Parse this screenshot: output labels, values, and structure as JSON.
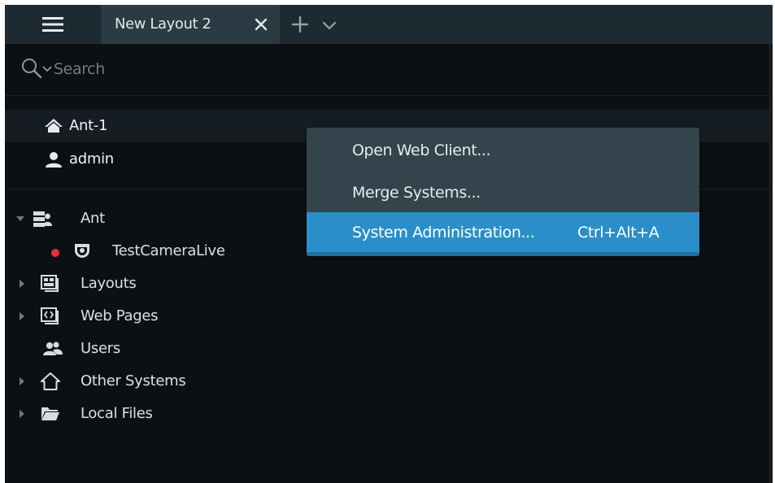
{
  "titlebar": {
    "main_menu_icon": "hamburger-menu-icon",
    "tab": {
      "label": "New Layout 2",
      "close_icon": "close-icon"
    },
    "add_tab_icon": "plus-icon",
    "tabs_dropdown_icon": "chevron-down-icon"
  },
  "search": {
    "icon": "search-icon",
    "placeholder": "Search",
    "value": ""
  },
  "tree": {
    "top_items": [
      {
        "label": "Ant-1",
        "icon": "home-icon",
        "selected": true
      },
      {
        "label": "admin",
        "icon": "user-icon"
      }
    ],
    "items": [
      {
        "label": "Ant",
        "icon": "server-icon",
        "expanded": true
      },
      {
        "label": "TestCameraLive",
        "icon": "camera-icon",
        "status": "recording",
        "status_color": "#e8303b"
      },
      {
        "label": "Layouts",
        "icon": "layouts-icon",
        "expanded": false
      },
      {
        "label": "Web Pages",
        "icon": "web-pages-icon",
        "expanded": false
      },
      {
        "label": "Users",
        "icon": "users-icon"
      },
      {
        "label": "Other Systems",
        "icon": "other-systems-icon",
        "expanded": false
      },
      {
        "label": "Local Files",
        "icon": "folder-icon",
        "expanded": false
      }
    ]
  },
  "context_menu": {
    "items": [
      {
        "label": "Open Web Client...",
        "shortcut": ""
      },
      {
        "label": "Merge Systems...",
        "shortcut": ""
      },
      {
        "label": "System Administration...",
        "shortcut": "Ctrl+Alt+A",
        "highlighted": true
      }
    ]
  },
  "colors": {
    "background": "#0c1013",
    "titlebar": "#1e2a31",
    "active_tab": "#2b3a43",
    "menu_background": "#34444c",
    "menu_highlight": "#2a8fc8",
    "recording_dot": "#e8303b"
  }
}
